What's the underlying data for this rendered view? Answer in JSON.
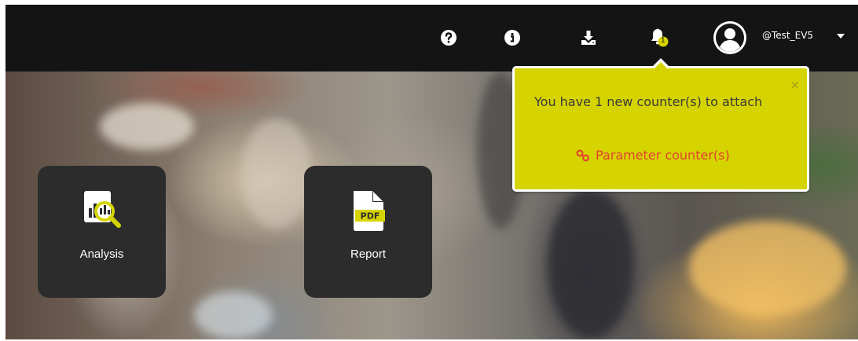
{
  "header": {
    "icons": [
      {
        "name": "help-icon"
      },
      {
        "name": "info-icon"
      },
      {
        "name": "download-icon"
      },
      {
        "name": "bell-icon"
      }
    ],
    "notification_count": "1",
    "username": "@Test_EV5"
  },
  "tiles": [
    {
      "label": "Analysis",
      "icon": "analysis-icon"
    },
    {
      "label": "Report",
      "icon": "pdf-icon",
      "icon_text": "PDF"
    }
  ],
  "notification": {
    "message": "You have 1 new counter(s) to attach",
    "close": "×",
    "link_label": "Parameter counter(s)"
  },
  "colors": {
    "topbar": "#141414",
    "popup_bg": "#d6d400",
    "link": "#e0422e",
    "tile_bg": "#2c2c2c",
    "badge": "#d6d400"
  }
}
